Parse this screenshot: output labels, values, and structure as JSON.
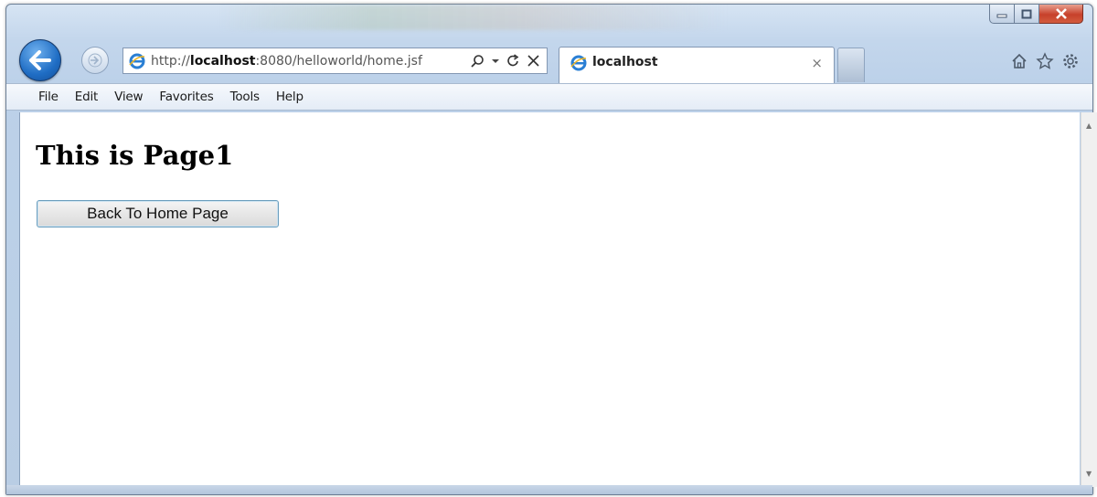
{
  "browser": {
    "address_bar": {
      "url_protocol": "http://",
      "url_host": "localhost",
      "url_path": ":8080/helloworld/home.jsf"
    },
    "tab": {
      "title": "localhost",
      "close_label": "×"
    },
    "menu": [
      "File",
      "Edit",
      "View",
      "Favorites",
      "Tools",
      "Help"
    ],
    "icons": [
      "back-arrow-icon",
      "forward-arrow-icon",
      "ie-logo-icon",
      "search-icon",
      "dropdown-icon",
      "refresh-icon",
      "stop-icon",
      "home-icon",
      "favorites-star-icon",
      "settings-gear-icon",
      "minimize-icon",
      "maximize-icon",
      "close-icon"
    ],
    "colors": {
      "back_button": "#1f6dc4",
      "close_button": "#c7412b",
      "frame": "#bcd1e9"
    }
  },
  "page": {
    "heading": "This is Page1",
    "button_label": "Back To Home Page"
  }
}
